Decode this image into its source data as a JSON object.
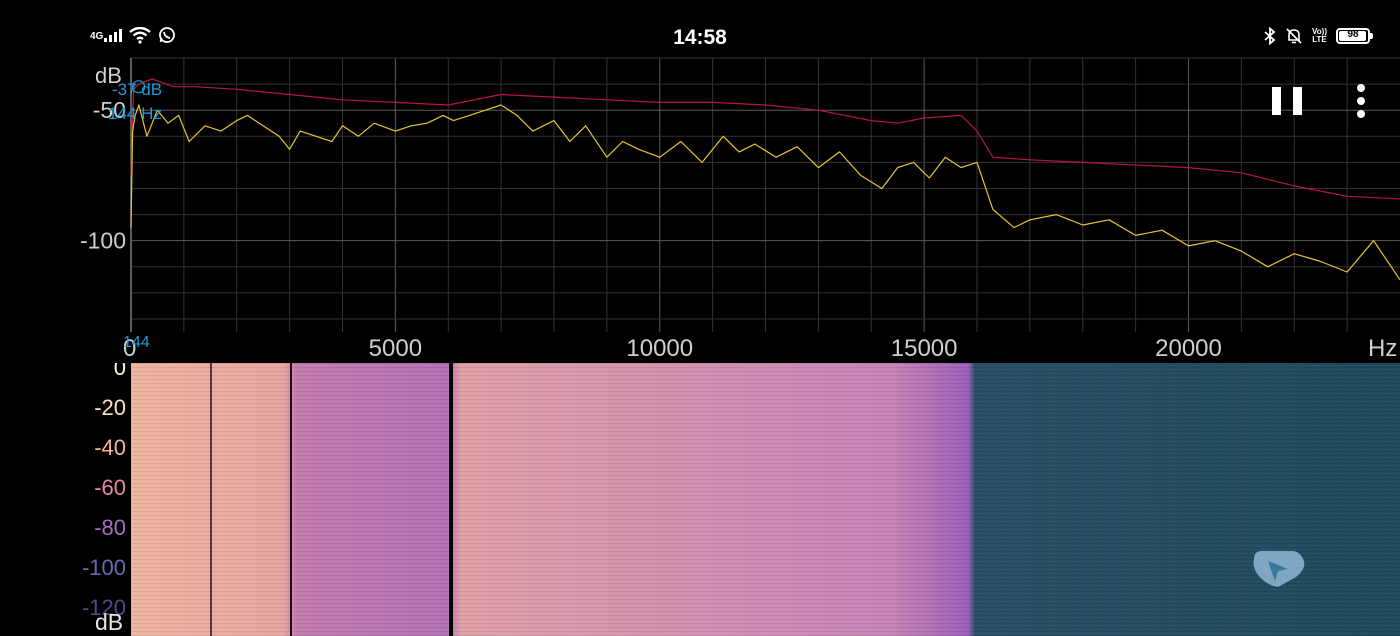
{
  "status_bar": {
    "network": "4G",
    "time": "14:58",
    "volte_top": "Vo))",
    "volte_bottom": "LTE",
    "battery_percent": 98,
    "battery_label": "98",
    "icons": [
      "signal-icon",
      "wifi-icon",
      "whatsapp-icon",
      "bluetooth-icon",
      "mute-icon",
      "volte-icon",
      "battery-icon"
    ]
  },
  "spectrum": {
    "y_unit": "dB",
    "x_unit": "Hz",
    "y_ticks": [
      "-50",
      "-100"
    ],
    "x_ticks": [
      "0",
      "5000",
      "10000",
      "15000",
      "20000"
    ],
    "xlim": [
      0,
      24000
    ],
    "ylim": [
      -135,
      -30
    ],
    "cursor": {
      "db_label": "-37 dB",
      "hz_label": "144 Hz",
      "axis_label": "144"
    },
    "colors": {
      "peak": "#b8153e",
      "current": "#e6c62e",
      "cursor": "#1e9ad6",
      "grid": "#3b3b3b"
    }
  },
  "chart_data": {
    "type": "line",
    "xlabel": "Hz",
    "ylabel": "dB",
    "xlim": [
      0,
      24000
    ],
    "ylim": [
      -135,
      -30
    ],
    "series": [
      {
        "color": "#b8153e",
        "x": [
          0,
          50,
          150,
          400,
          800,
          1200,
          2000,
          3000,
          4000,
          5000,
          6000,
          7000,
          8000,
          9000,
          10000,
          11000,
          12000,
          13000,
          14000,
          14500,
          15000,
          15700,
          16000,
          16300,
          17000,
          18000,
          19000,
          20000,
          21000,
          22000,
          23000,
          24000
        ],
        "y": [
          -75,
          -42,
          -40,
          -38,
          -41,
          -41,
          -42,
          -44,
          -46,
          -47,
          -48,
          -44,
          -45,
          -46,
          -47,
          -47,
          -48,
          -50,
          -54,
          -55,
          -53,
          -52,
          -58,
          -68,
          -69,
          -70,
          -71,
          -72,
          -74,
          -79,
          -83,
          -84
        ]
      },
      {
        "color": "#e6c62e",
        "x": [
          0,
          30,
          80,
          150,
          300,
          500,
          700,
          900,
          1100,
          1400,
          1700,
          2000,
          2200,
          2500,
          2800,
          3000,
          3200,
          3500,
          3800,
          4000,
          4300,
          4600,
          5000,
          5300,
          5600,
          5900,
          6100,
          6400,
          6700,
          7000,
          7300,
          7600,
          8000,
          8300,
          8600,
          9000,
          9300,
          9600,
          10000,
          10400,
          10800,
          11200,
          11500,
          11800,
          12200,
          12600,
          13000,
          13400,
          13800,
          14200,
          14500,
          14800,
          15100,
          15400,
          15700,
          16000,
          16300,
          16700,
          17000,
          17500,
          18000,
          18500,
          19000,
          19500,
          20000,
          20500,
          21000,
          21500,
          22000,
          22500,
          23000,
          23500,
          24000
        ],
        "y": [
          -95,
          -58,
          -52,
          -48,
          -60,
          -50,
          -55,
          -52,
          -62,
          -56,
          -58,
          -54,
          -52,
          -56,
          -60,
          -65,
          -58,
          -60,
          -62,
          -56,
          -60,
          -55,
          -58,
          -56,
          -55,
          -52,
          -54,
          -52,
          -50,
          -48,
          -52,
          -58,
          -54,
          -62,
          -56,
          -68,
          -62,
          -65,
          -68,
          -62,
          -70,
          -60,
          -66,
          -63,
          -68,
          -64,
          -72,
          -66,
          -75,
          -80,
          -72,
          -70,
          -76,
          -68,
          -72,
          -70,
          -88,
          -95,
          -92,
          -90,
          -94,
          -92,
          -98,
          -96,
          -102,
          -100,
          -104,
          -110,
          -105,
          -108,
          -112,
          -100,
          -115
        ]
      }
    ]
  },
  "spectrogram": {
    "y_unit": "dB",
    "y_ticks": [
      "0",
      "-20",
      "-40",
      "-60",
      "-80",
      "-100",
      "-120"
    ],
    "tick_colors": [
      "#fff6dc",
      "#fde0bf",
      "#f4b493",
      "#e687a4",
      "#ab6ac5",
      "#6a6ab0",
      "#4a4c92"
    ]
  }
}
